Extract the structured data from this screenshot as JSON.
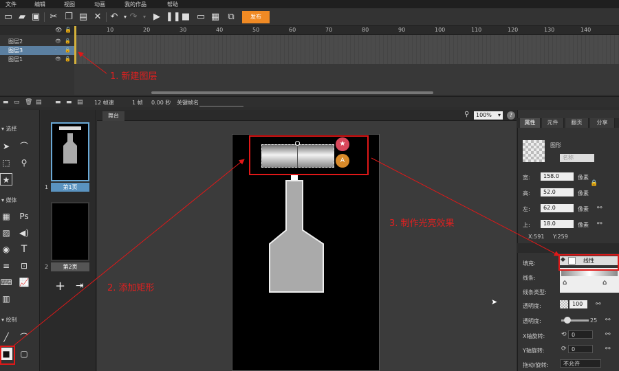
{
  "menu": [
    "文件",
    "编辑",
    "视图",
    "动画",
    "我的作品",
    "帮助"
  ],
  "toolbar": {
    "publish_label": "发布"
  },
  "timeline": {
    "layers": [
      "图层2",
      "图层3",
      "图层1"
    ],
    "ticks": [
      "10",
      "20",
      "30",
      "40",
      "50",
      "60",
      "70",
      "80",
      "90",
      "100",
      "110",
      "120",
      "130",
      "140"
    ],
    "status": {
      "fps": "12 帧速",
      "frame": "1 帧",
      "seconds": "0.00 秒",
      "keyframe_name": "关键帧名"
    }
  },
  "tools": {
    "groups": [
      "选择",
      "媒体",
      "绘制"
    ],
    "ps": "Ps",
    "text_tool": "T"
  },
  "pages": {
    "items": [
      {
        "num": "1",
        "label": "第1页"
      },
      {
        "num": "2",
        "label": "第2页"
      }
    ]
  },
  "stage": {
    "tab": "舞台",
    "zoom": "100%",
    "help": "?",
    "badge_a": "A"
  },
  "props": {
    "tabs": [
      "属性",
      "元件",
      "翻页",
      "分享"
    ],
    "object_type": "图形",
    "name_placeholder": "名称",
    "width_label": "宽:",
    "width": "158.0",
    "height_label": "高:",
    "height": "52.0",
    "left_label": "左:",
    "left": "62.0",
    "top_label": "上:",
    "top": "18.0",
    "unit": "像素",
    "coords_x": "X:591",
    "coords_y": "Y:259",
    "fill_label": "填充:",
    "fill_type": "线性",
    "stroke_label": "线条:",
    "stroke_type_label": "线条类型:",
    "opacity_label": "透明度:",
    "opacity": "100",
    "blur_label": "透明度:",
    "blur_value": "25",
    "x_rot_label": "X轴旋转:",
    "x_rot": "0",
    "y_rot_label": "Y轴旋转:",
    "y_rot": "0",
    "drag_label": "拖动/旋转:",
    "drag_value": "不允许"
  },
  "annotations": {
    "step1": "1. 新建图层",
    "step2": "2. 添加矩形",
    "step3": "3. 制作光亮效果"
  }
}
